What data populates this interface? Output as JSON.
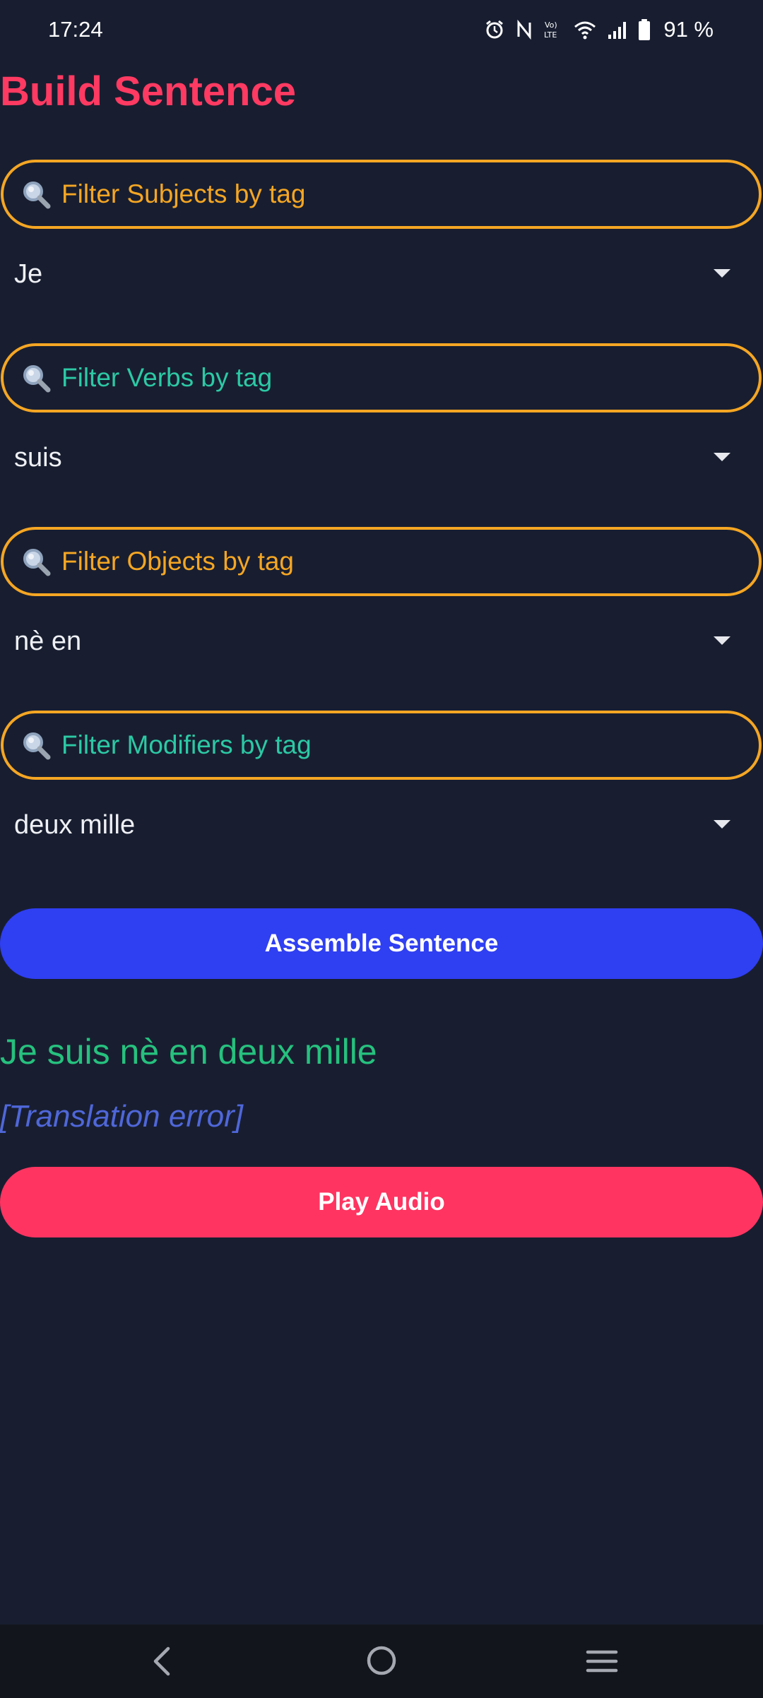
{
  "status_bar": {
    "time": "17:24",
    "battery": "91 %",
    "icons": [
      "alarm-icon",
      "nfc-icon",
      "volte-icon",
      "wifi-icon",
      "signal-icon",
      "battery-icon"
    ]
  },
  "title": "Build Sentence",
  "filters": {
    "subjects_placeholder": "Filter Subjects by tag",
    "verbs_placeholder": "Filter Verbs by tag",
    "objects_placeholder": "Filter Objects by tag",
    "modifiers_placeholder": "Filter Modifiers by tag"
  },
  "dropdowns": {
    "subject": "Je",
    "verb": "suis",
    "object": "nè en",
    "modifier": "deux mille"
  },
  "buttons": {
    "assemble": "Assemble Sentence",
    "play": "Play Audio"
  },
  "result": {
    "sentence": "Je suis nè en deux mille",
    "translation": "[Translation error]"
  },
  "colors": {
    "background": "#181e30",
    "title": "#ff3a62",
    "filter_border": "#f5a623",
    "filter_text_orange": "#f5a623",
    "filter_text_teal": "#2cc9a5",
    "assemble_button": "#2f3ff2",
    "play_button": "#ff3461",
    "sentence": "#26c17e",
    "translation": "#4f67d9"
  },
  "nav": {
    "icons": [
      "back-icon",
      "home-icon",
      "recent-apps-icon"
    ]
  }
}
